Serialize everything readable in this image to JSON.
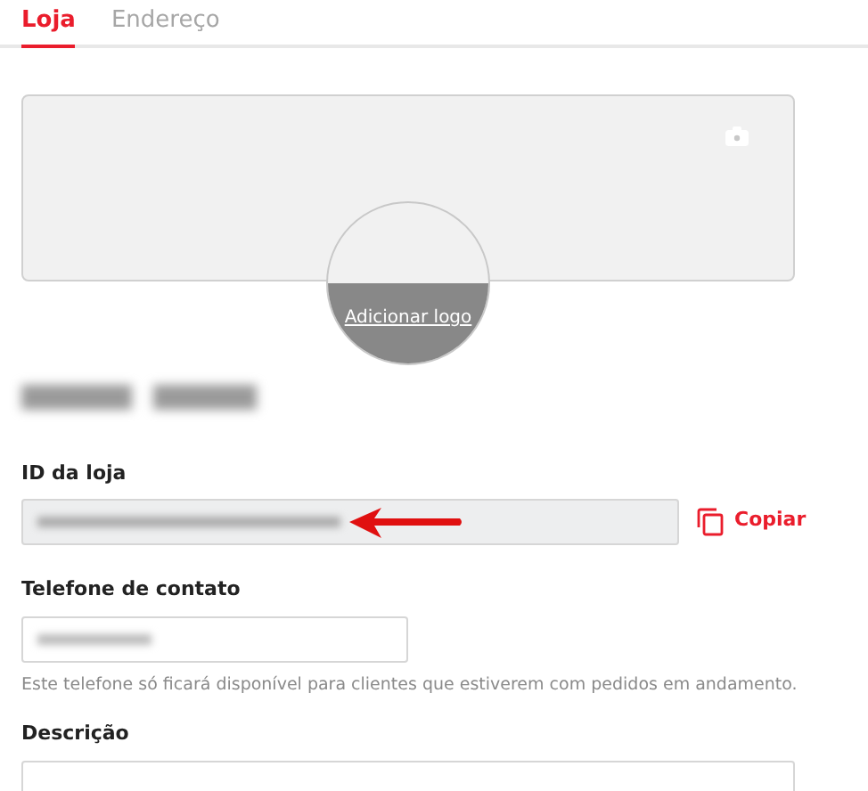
{
  "tabs": [
    {
      "label": "Loja",
      "selected": true
    },
    {
      "label": "Endereço",
      "selected": false
    }
  ],
  "logo": {
    "label": "Adicionar logo"
  },
  "store_id": {
    "label": "ID da loja",
    "copy_label": "Copiar"
  },
  "phone": {
    "label": "Telefone de contato",
    "helper": "Este telefone só ficará disponível para clientes que estiverem com pedidos em andamento."
  },
  "description": {
    "label": "Descrição"
  }
}
